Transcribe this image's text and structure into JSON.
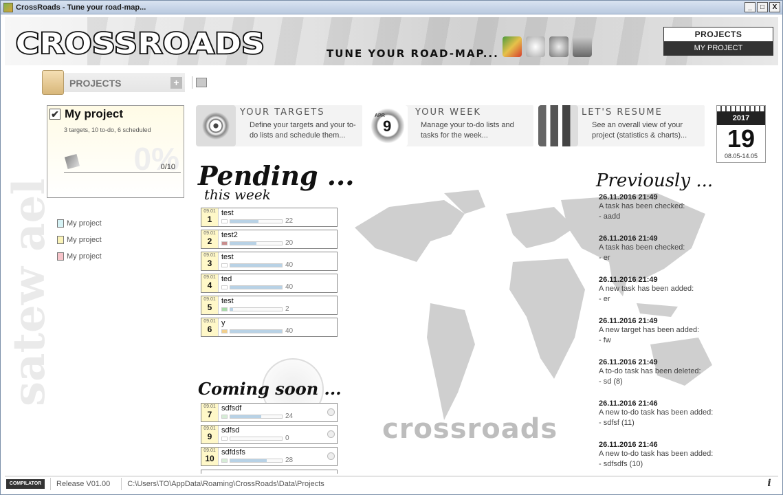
{
  "window": {
    "title": "CrossRoads - Tune your road-map...",
    "min": "_",
    "max": "□",
    "close": "X"
  },
  "banner": {
    "logo": "CROSSROADS",
    "tagline": "TUNE YOUR ROAD-MAP...",
    "nav_projects": "PROJECTS",
    "nav_my_project": "MY PROJECT"
  },
  "sidebar": {
    "header": "PROJECTS",
    "add_label": "+",
    "project": {
      "check": "✔",
      "title": "My project",
      "summary": "3 targets, 10 to-do, 6 scheduled",
      "percent": "0%",
      "count": "0/10"
    },
    "legend": [
      {
        "label": "My project",
        "color": "#d6f3f6"
      },
      {
        "label": "My project",
        "color": "#fbf4b9"
      },
      {
        "label": "My project",
        "color": "#f7c4ca"
      }
    ],
    "watermark": "satew ael"
  },
  "features": {
    "targets": {
      "title": "YOUR TARGETS",
      "desc": "Define your targets and your to-do lists and schedule them..."
    },
    "week": {
      "title": "YOUR WEEK",
      "desc": "Manage your to-do lists and tasks for the week...",
      "icon_label": "9",
      "icon_month": "APR"
    },
    "resume": {
      "title": "LET'S RESUME",
      "desc": "See an overall view of your project (statistics & charts)..."
    }
  },
  "calendar": {
    "year": "2017",
    "day": "19",
    "range": "08.05-14.05"
  },
  "pending": {
    "title": "Pending ...",
    "subtitle": "this week",
    "tasks": [
      {
        "date": "09.01",
        "num": "1",
        "name": "test",
        "value": "22",
        "progress": 0.55,
        "prio": "#ffffff"
      },
      {
        "date": "09.01",
        "num": "2",
        "name": "test2",
        "value": "20",
        "progress": 0.5,
        "prio": "#c98d8d"
      },
      {
        "date": "09.01",
        "num": "3",
        "name": "test",
        "value": "40",
        "progress": 1.0,
        "prio": "#ffffff"
      },
      {
        "date": "09.01",
        "num": "4",
        "name": "ted",
        "value": "40",
        "progress": 1.0,
        "prio": "#ffffff"
      },
      {
        "date": "09.01",
        "num": "5",
        "name": "test",
        "value": "2",
        "progress": 0.05,
        "prio": "#a8dba8"
      },
      {
        "date": "09.01",
        "num": "6",
        "name": "y",
        "value": "40",
        "progress": 1.0,
        "prio": "#f2cf8c"
      }
    ]
  },
  "coming": {
    "title": "Coming soon ...",
    "tasks": [
      {
        "date": "09.01",
        "num": "7",
        "name": "sdfsdf",
        "value": "24",
        "progress": 0.6,
        "prio": "#d6ecd6"
      },
      {
        "date": "09.01",
        "num": "9",
        "name": "sdfsd",
        "value": "0",
        "progress": 0.0,
        "prio": "#ffffff"
      },
      {
        "date": "09.01",
        "num": "10",
        "name": "sdfdsfs",
        "value": "28",
        "progress": 0.7,
        "prio": "#d6ecd6"
      }
    ]
  },
  "previously": {
    "title": "Previously ...",
    "entries": [
      {
        "time": "26.11.2016 21:49",
        "text": "A task has been checked:",
        "detail": "- aadd"
      },
      {
        "time": "26.11.2016 21:49",
        "text": "A task has been checked:",
        "detail": "- er"
      },
      {
        "time": "26.11.2016 21:49",
        "text": "A new task has been added:",
        "detail": "- er"
      },
      {
        "time": "26.11.2016 21:49",
        "text": "A new target has been added:",
        "detail": "- fw"
      },
      {
        "time": "26.11.2016 21:49",
        "text": "A to-do task has been deleted:",
        "detail": "- sd (8)"
      },
      {
        "time": "26.11.2016 21:46",
        "text": "A new to-do task has been added:",
        "detail": "- sdfsf (11)"
      },
      {
        "time": "26.11.2016 21:46",
        "text": "A new to-do task has been added:",
        "detail": "- sdfsdfs (10)"
      }
    ]
  },
  "map_brand": "crossroads",
  "statusbar": {
    "logo": "COMPILATOR",
    "release": "Release V01.00",
    "path": "C:\\Users\\TO\\AppData\\Roaming\\CrossRoads\\Data\\Projects",
    "info": "i"
  }
}
